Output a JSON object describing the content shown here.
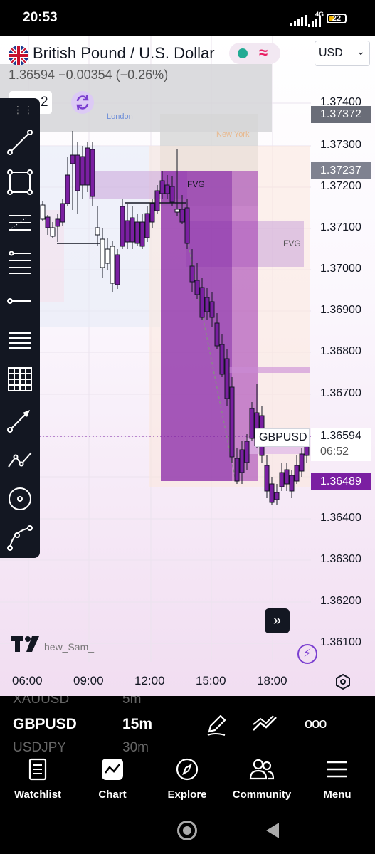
{
  "status_bar": {
    "time": "20:53",
    "network": "4G",
    "battery": "22"
  },
  "header": {
    "title": "British Pound / U.S. Dollar",
    "price_readout": "1.36594  −0.00354 (−0.26%)",
    "currency": "USD",
    "interval_fragment": "2"
  },
  "chart_overlay": {
    "session_london": "London",
    "session_new_york": "New York",
    "fvg_label_1": "FVG",
    "fvg_label_2": "FVG",
    "symbol_tag": "GBPUSD",
    "countdown": "06:52",
    "watermark": "hew_Sam_"
  },
  "chart_data": {
    "type": "candlestick",
    "price_ticks": [
      "1.37400",
      "1.37300",
      "1.37200",
      "1.37100",
      "1.37000",
      "1.36900",
      "1.36800",
      "1.36700",
      "1.36600",
      "1.36400",
      "1.36300",
      "1.36200",
      "1.36100"
    ],
    "time_ticks": [
      "06:00",
      "09:00",
      "12:00",
      "15:00",
      "18:00"
    ],
    "price_labels": [
      {
        "value": "1.37372",
        "color": "#6a6d78"
      },
      {
        "value": "1.37237",
        "color": "#7f8290"
      },
      {
        "value": "1.36594",
        "color": "#ffffff"
      },
      {
        "value": "1.36489",
        "color": "#7b1fa2"
      }
    ],
    "current_price": "1.36594",
    "candle_color": "#7b1fa2",
    "accent": "#9c27b0"
  },
  "symbol_strip": {
    "prev_symbol": "XAUUSD",
    "prev_interval": "5m",
    "symbol": "GBPUSD",
    "interval": "15m",
    "next_symbol": "USDJPY",
    "next_interval": "30m"
  },
  "nav": {
    "watchlist": "Watchlist",
    "chart": "Chart",
    "explore": "Explore",
    "community": "Community",
    "menu": "Menu"
  }
}
